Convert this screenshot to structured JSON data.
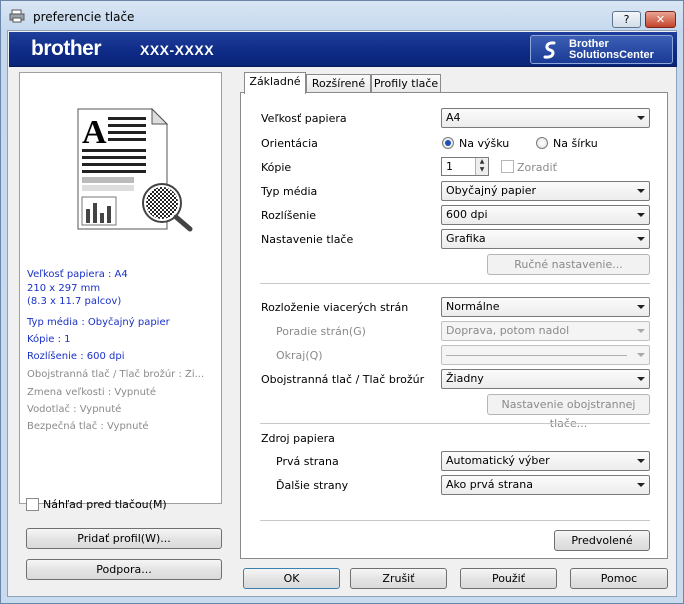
{
  "window": {
    "title": "preferencie tlače",
    "help_label": "?",
    "close_label": "✕"
  },
  "banner": {
    "brand": "brother",
    "model": "XXX-XXXX",
    "solutions_line1": "Brother",
    "solutions_line2": "SolutionsCenter"
  },
  "summary": {
    "paper_size": "Veľkosť papiera : A4",
    "paper_mm": "210 x 297 mm",
    "paper_in": "(8.3 x 11.7 palcov)",
    "media_type": "Typ média : Obyčajný papier",
    "copies": "Kópie : 1",
    "resolution": "Rozlíšenie : 600 dpi",
    "duplex": "Obojstranná tlač / Tlač brožúr : Ži...",
    "scaling": "Zmena veľkosti : Vypnuté",
    "watermark": "Vodotlač : Vypnuté",
    "secure": "Bezpečná tlač : Vypnuté"
  },
  "preview_checkbox": "Náhľad pred tlačou(M)",
  "add_profile_button": "Pridať profil(W)...",
  "support_button": "Podpora...",
  "tabs": [
    "Základné",
    "Rozšírené",
    "Profily tlače"
  ],
  "form": {
    "paper_size_label": "Veľkosť papiera",
    "paper_size_value": "A4",
    "orientation_label": "Orientácia",
    "portrait_label": "Na výšku",
    "landscape_label": "Na šírku",
    "copies_label": "Kópie",
    "copies_value": "1",
    "collate_label": "Zoradiť",
    "media_label": "Typ média",
    "media_value": "Obyčajný papier",
    "resolution_label": "Rozlíšenie",
    "resolution_value": "600 dpi",
    "print_setting_label": "Nastavenie tlače",
    "print_setting_value": "Grafika",
    "manual_button": "Ručné nastavenie...",
    "multipage_label": "Rozloženie viacerých strán",
    "multipage_value": "Normálne",
    "page_order_label": "Poradie strán(G)",
    "page_order_value": "Doprava, potom nadol",
    "border_label": "Okraj(Q)",
    "duplex_label": "Obojstranná tlač / Tlač brožúr",
    "duplex_value": "Žiadny",
    "duplex_button": "Nastavenie obojstrannej tlače...",
    "source_label": "Zdroj papiera",
    "first_page_label": "Prvá strana",
    "first_page_value": "Automatický výber",
    "other_pages_label": "Ďalšie strany",
    "other_pages_value": "Ako prvá strana",
    "default_button": "Predvolené"
  },
  "footer": {
    "ok": "OK",
    "cancel": "Zrušiť",
    "apply": "Použiť",
    "help": "Pomoc"
  }
}
